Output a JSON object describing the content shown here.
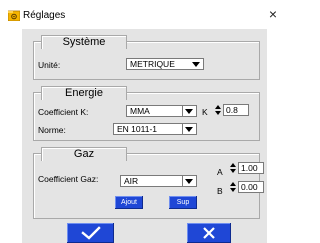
{
  "window": {
    "title": "Réglages",
    "close_glyph": "×",
    "icon": "folder-gear-icon"
  },
  "systeme": {
    "title": "Système",
    "unite_label": "Unité:",
    "unite_value": "METRIQUE"
  },
  "energie": {
    "title": "Energie",
    "coef_label": "Coefficient K:",
    "coef_value": "MMA",
    "k_label": "K",
    "k_value": "0.8",
    "norme_label": "Norme:",
    "norme_value": "EN 1011-1"
  },
  "gaz": {
    "title": "Gaz",
    "coef_label": "Coefficient Gaz:",
    "coef_value": "AIR",
    "a_label": "A",
    "a_value": "1.00",
    "b_label": "B",
    "b_value": "0.00",
    "add_label": "Ajout",
    "del_label": "Sup"
  },
  "actions": {
    "ok_icon": "checkmark-icon",
    "cancel_icon": "x-icon"
  },
  "colors": {
    "accent": "#1f47d6",
    "panel": "#e4e4e4"
  }
}
